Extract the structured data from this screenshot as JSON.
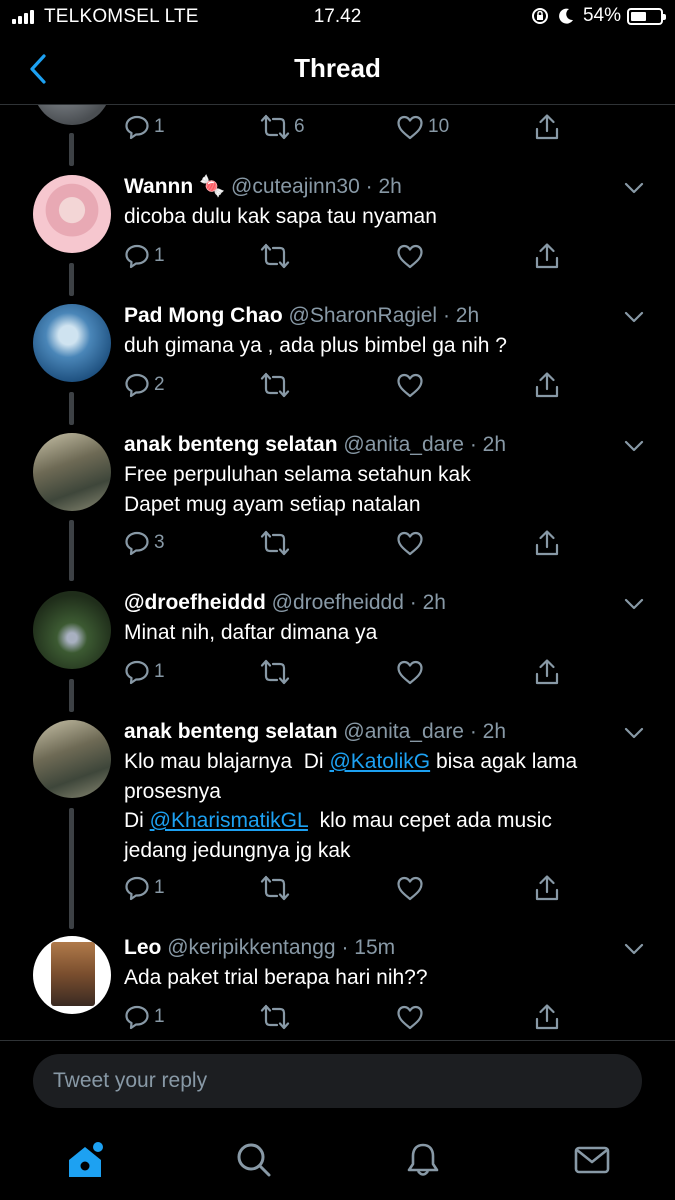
{
  "status_bar": {
    "carrier": "TELKOMSEL LTE",
    "time": "17.42",
    "battery": "54%",
    "battery_level": 0.54
  },
  "header": {
    "title": "Thread",
    "back_icon": "chevron-left-icon"
  },
  "top_actions": {
    "replies": "1",
    "retweets": "6",
    "likes": "10"
  },
  "tweets": [
    {
      "name": "Wannn 🍬",
      "handle": "@cuteajinn30",
      "time": "· 2h",
      "lines": [
        "dicoba dulu kak sapa tau nyaman"
      ],
      "replies": "1",
      "retweets": "",
      "likes": ""
    },
    {
      "name": "Pad Mong Chao",
      "handle": "@SharonRagiel",
      "time": "· 2h",
      "lines": [
        "duh gimana ya , ada plus bimbel ga nih ?"
      ],
      "replies": "2",
      "retweets": "",
      "likes": ""
    },
    {
      "name": "anak benteng selatan",
      "handle": "@anita_dare",
      "time": "· 2h",
      "lines": [
        "Free perpuluhan selama setahun kak",
        "Dapet mug ayam setiap natalan"
      ],
      "replies": "3",
      "retweets": "",
      "likes": ""
    },
    {
      "name": "@droefheiddd",
      "handle": "@droefheiddd",
      "time": "· 2h",
      "lines": [
        "Minat nih, daftar dimana ya"
      ],
      "replies": "1",
      "retweets": "",
      "likes": ""
    },
    {
      "name": "anak benteng selatan",
      "handle": "@anita_dare",
      "time": "· 2h",
      "line1_pre": "Klo mau blajarnya  Di ",
      "line1_mention": "@KatolikG",
      "line1_post": " bisa agak lama",
      "line2": "prosesnya",
      "line3_pre": "Di ",
      "line3_mention": "@KharismatikGL",
      "line3_post": "  klo mau cepet ada music",
      "line4": "jedang jedungnya jg kak",
      "replies": "1",
      "retweets": "",
      "likes": ""
    },
    {
      "name": "Leo",
      "handle": "@keripikkentangg",
      "time": "· 15m",
      "lines": [
        "Ada paket trial berapa hari nih??"
      ],
      "replies": "1",
      "retweets": "",
      "likes": ""
    }
  ],
  "reply": {
    "placeholder": "Tweet your reply"
  },
  "tabs": [
    "home-icon",
    "search-icon",
    "bell-icon",
    "mail-icon"
  ],
  "colors": {
    "accent": "#1da1f2",
    "muted": "#8899a6",
    "background": "#000000"
  }
}
